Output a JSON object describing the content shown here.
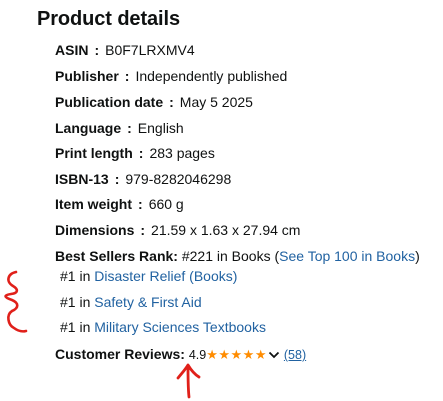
{
  "section_title": "Product details",
  "details": [
    {
      "label": "ASIN",
      "value": "B0F7LRXMV4"
    },
    {
      "label": "Publisher",
      "value": "Independently published"
    },
    {
      "label": "Publication date",
      "value": "May 5 2025"
    },
    {
      "label": "Language",
      "value": "English"
    },
    {
      "label": "Print length",
      "value": "283 pages"
    },
    {
      "label": "ISBN-13",
      "value": "979-8282046298"
    },
    {
      "label": "Item weight",
      "value": "660 g"
    },
    {
      "label": "Dimensions",
      "value": "21.59 x 1.63 x 27.94 cm"
    }
  ],
  "colon": ":",
  "best_sellers": {
    "label": "Best Sellers Rank:",
    "main_rank": "#221 in Books (",
    "top100_link": "See Top 100 in Books",
    "close_paren": ")",
    "sub_ranks": [
      {
        "rank": "#1 in ",
        "category": "Disaster Relief (Books)"
      },
      {
        "rank": "#1 in ",
        "category": "Safety & First Aid"
      },
      {
        "rank": "#1 in ",
        "category": "Military Sciences Textbooks"
      }
    ]
  },
  "reviews": {
    "label": "Customer Reviews:",
    "rating": "4.9",
    "stars": "★★★★★",
    "count": "(58)"
  },
  "colors": {
    "link": "#2162a1",
    "star": "#ff8c00",
    "annotation": "#e0201a"
  }
}
